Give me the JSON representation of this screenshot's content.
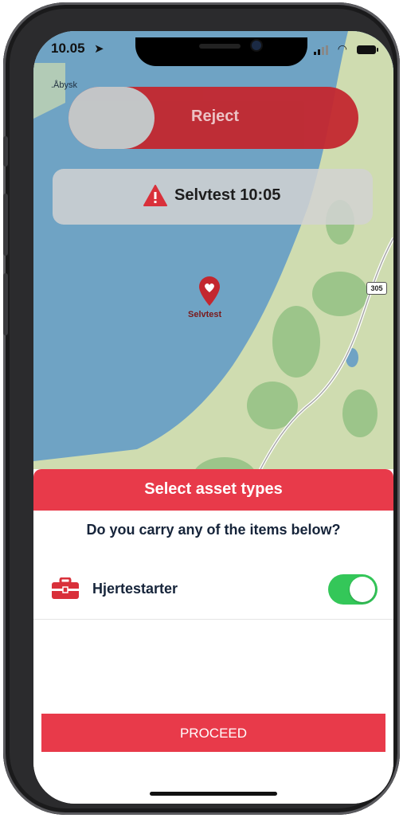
{
  "status_bar": {
    "time": "10.05"
  },
  "map": {
    "place_label": ".Åbysk",
    "pin_label": "Selvtest",
    "road_number": "305"
  },
  "reject_slider": {
    "label": "Reject"
  },
  "alert_banner": {
    "text": "Selvtest 10:05"
  },
  "sheet": {
    "title": "Select asset types",
    "question": "Do you carry any of the items below?",
    "assets": [
      {
        "label": "Hjertestarter",
        "enabled": true
      }
    ],
    "proceed_label": "PROCEED"
  },
  "colors": {
    "accent": "#e83a4a",
    "reject": "#c3272f",
    "toggle_on": "#34c759",
    "water": "#6fa3c4",
    "land": "#cfdcb0",
    "text_dark": "#16243a"
  },
  "icons": {
    "location": "location-arrow-icon",
    "alert": "warning-triangle-icon",
    "pin": "heart-pin-icon",
    "asset": "toolbox-icon"
  }
}
